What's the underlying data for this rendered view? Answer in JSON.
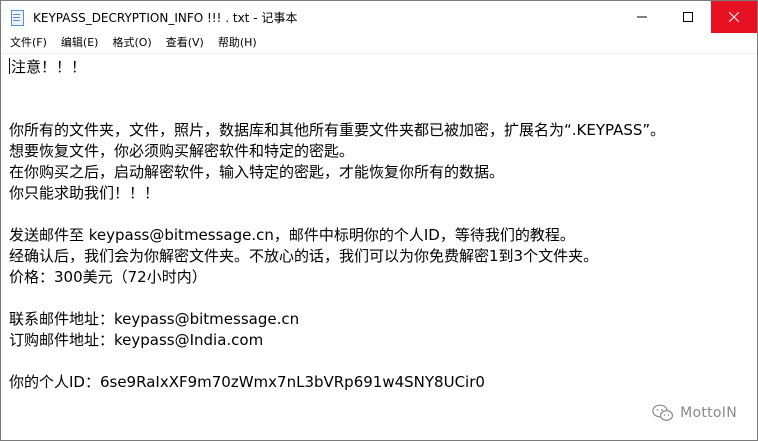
{
  "window": {
    "title": "KEYPASS_DECRYPTION_INFO !!! . txt - 记事本"
  },
  "menu": [
    {
      "label": "文件(F)"
    },
    {
      "label": "编辑(E)"
    },
    {
      "label": "格式(O)"
    },
    {
      "label": "查看(V)"
    },
    {
      "label": "帮助(H)"
    }
  ],
  "document": {
    "line1": "注意！！！",
    "line2": "你所有的文件夹，文件，照片，数据库和其他所有重要文件夹都已被加密，扩展名为“.KEYPASS”。",
    "line3": "想要恢复文件，你必须购买解密软件和特定的密匙。",
    "line4": "在你购买之后，启动解密软件，输入特定的密匙，才能恢复你所有的数据。",
    "line5": "你只能求助我们！！！",
    "line6": "发送邮件至 keypass@bitmessage.cn，邮件中标明你的个人ID，等待我们的教程。",
    "line7": "经确认后，我们会为你解密文件夹。不放心的话，我们可以为你免费解密1到3个文件夹。",
    "line8": "价格：300美元（72小时内）",
    "line9": "联系邮件地址：keypass@bitmessage.cn",
    "line10": "订购邮件地址：keypass@India.com",
    "line11": "你的个人ID：6se9RaIxXF9m70zWmx7nL3bVRp691w4SNY8UCir0"
  },
  "watermark": {
    "text": "MottoIN",
    "icon": "wechat-icon"
  },
  "colors": {
    "close_button": "#e81123",
    "window_border": "#7a7a7a",
    "watermark": "#8a8a8a"
  }
}
